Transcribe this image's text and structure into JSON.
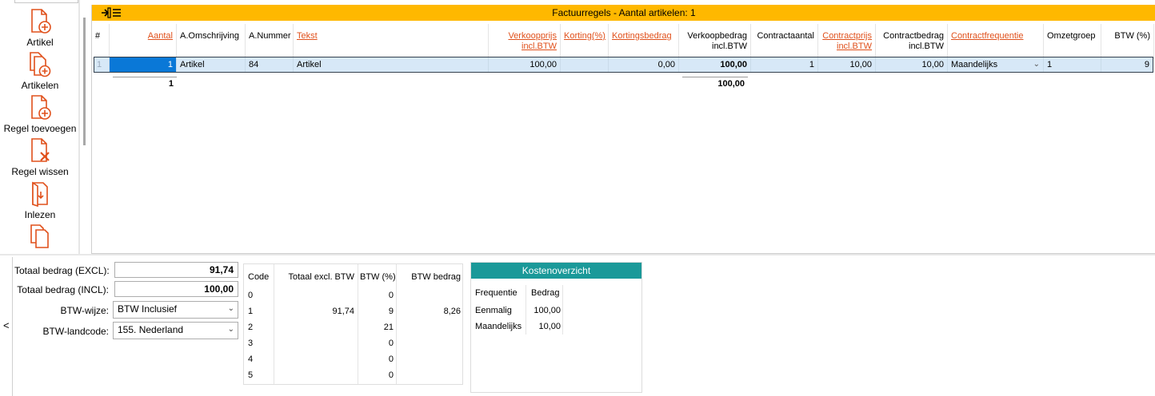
{
  "toolbar": {
    "items": [
      {
        "label": "Artikel",
        "icon": "document-add-icon"
      },
      {
        "label": "Artikelen",
        "icon": "documents-add-icon"
      },
      {
        "label": "Regel toevoegen",
        "icon": "document-add-icon"
      },
      {
        "label": "Regel wissen",
        "icon": "document-delete-icon"
      },
      {
        "label": "Inlezen",
        "icon": "document-import-icon"
      },
      {
        "label": "",
        "icon": "documents-copy-icon"
      }
    ],
    "accent": "#e0501b"
  },
  "grid": {
    "title": "Factuurregels - Aantal artikelen: 1",
    "title_bg": "#ffb800",
    "columns": [
      {
        "key": "hash",
        "label": "#"
      },
      {
        "key": "aantal",
        "label": "Aantal"
      },
      {
        "key": "omschrijving",
        "label": "A.Omschrijving"
      },
      {
        "key": "nummer",
        "label": "A.Nummer"
      },
      {
        "key": "tekst",
        "label": "Tekst"
      },
      {
        "key": "verkoopprijs",
        "label": "Verkoopprijs incl.BTW"
      },
      {
        "key": "korting",
        "label": "Korting(%)"
      },
      {
        "key": "kortingsbedrag",
        "label": "Kortingsbedrag"
      },
      {
        "key": "verkoopbedrag",
        "label": "Verkoopbedrag incl.BTW"
      },
      {
        "key": "contractaantal",
        "label": "Contractaantal"
      },
      {
        "key": "contractprijs",
        "label": "Contractprijs incl.BTW"
      },
      {
        "key": "contractbedrag",
        "label": "Contractbedrag incl.BTW"
      },
      {
        "key": "contractfrequentie",
        "label": "Contractfrequentie"
      },
      {
        "key": "omzetgroep",
        "label": "Omzetgroep"
      },
      {
        "key": "btw",
        "label": "BTW (%)"
      }
    ],
    "row": {
      "hash": "1",
      "aantal": "1",
      "omschrijving": "Artikel",
      "nummer": "84",
      "tekst": "Artikel",
      "verkoopprijs": "100,00",
      "korting": "",
      "kortingsbedrag": "0,00",
      "verkoopbedrag": "100,00",
      "contractaantal": "1",
      "contractprijs": "10,00",
      "contractbedrag": "10,00",
      "contractfrequentie": "Maandelijks",
      "omzetgroep": "1",
      "btw": "9"
    },
    "totals": {
      "aantal": "1",
      "verkoopbedrag": "100,00"
    }
  },
  "summary": {
    "totaal_excl_label": "Totaal bedrag (EXCL):",
    "totaal_excl_value": "91,74",
    "totaal_incl_label": "Totaal bedrag (INCL):",
    "totaal_incl_value": "100,00",
    "btw_wijze_label": "BTW-wijze:",
    "btw_wijze_value": "BTW Inclusief",
    "btw_landcode_label": "BTW-landcode:",
    "btw_landcode_value": "155. Nederland"
  },
  "btw_table": {
    "headers": {
      "code": "Code",
      "totaal": "Totaal excl. BTW",
      "pct": "BTW (%)",
      "bedrag": "BTW bedrag"
    },
    "rows": [
      {
        "code": "0",
        "totaal": "",
        "pct": "0",
        "bedrag": ""
      },
      {
        "code": "1",
        "totaal": "91,74",
        "pct": "9",
        "bedrag": "8,26"
      },
      {
        "code": "2",
        "totaal": "",
        "pct": "21",
        "bedrag": ""
      },
      {
        "code": "3",
        "totaal": "",
        "pct": "0",
        "bedrag": ""
      },
      {
        "code": "4",
        "totaal": "",
        "pct": "0",
        "bedrag": ""
      },
      {
        "code": "5",
        "totaal": "",
        "pct": "0",
        "bedrag": ""
      }
    ]
  },
  "kosten": {
    "title": "Kostenoverzicht",
    "title_bg": "#1a9999",
    "headers": {
      "frequentie": "Frequentie",
      "bedrag": "Bedrag"
    },
    "rows": [
      {
        "frequentie": "Eenmalig",
        "bedrag": "100,00"
      },
      {
        "frequentie": "Maandelijks",
        "bedrag": "10,00"
      }
    ]
  },
  "collapse_label": "<"
}
